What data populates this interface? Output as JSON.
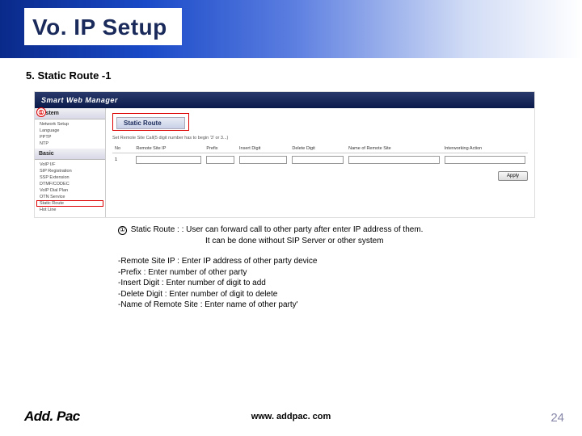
{
  "title": "Vo. IP Setup",
  "section": "5.  Static Route -1",
  "swm": {
    "header": "Smart Web Manager",
    "marker": "①",
    "sidebar": {
      "system_label": "System",
      "system_items": [
        "Network Setup",
        "Language",
        "PPTP",
        "NTP"
      ],
      "basic_label": "Basic",
      "basic_items": [
        "VoIP I/F",
        "SIP Registration",
        "SSP Extension",
        "DTMF/CODEC",
        "VoIP Dial Plan",
        "OTN Service"
      ],
      "static_route_item": "Static Route",
      "basic_tail": [
        "Hot Line"
      ]
    },
    "panel": {
      "title": "Static Route",
      "note": "Set Remote Site Call(5 digit number has to begin '3' or 3...)",
      "cols": [
        "No",
        "Remote Site IP",
        "Prefix",
        "Insert Digit",
        "Delete Digit",
        "Name of Remote Site",
        "Interworking Action"
      ],
      "row_no": "1",
      "apply": "Apply"
    }
  },
  "desc": {
    "num": "①",
    "line1a": "Static Route : :  User can forward call to other party after enter IP address of them.",
    "line1b": "It can be done without SIP Server or other system",
    "f1": "-Remote Site IP : Enter IP address of other party device",
    "f2": "-Prefix : Enter number of other party",
    "f3": "-Insert Digit : Enter number of digit to add",
    "f4": "-Delete Digit : Enter number of digit to delete",
    "f5": "-Name of Remote Site : Enter name of other party'"
  },
  "footer": {
    "brand": "Add. Pac",
    "url": "www. addpac. com",
    "page": "24"
  }
}
